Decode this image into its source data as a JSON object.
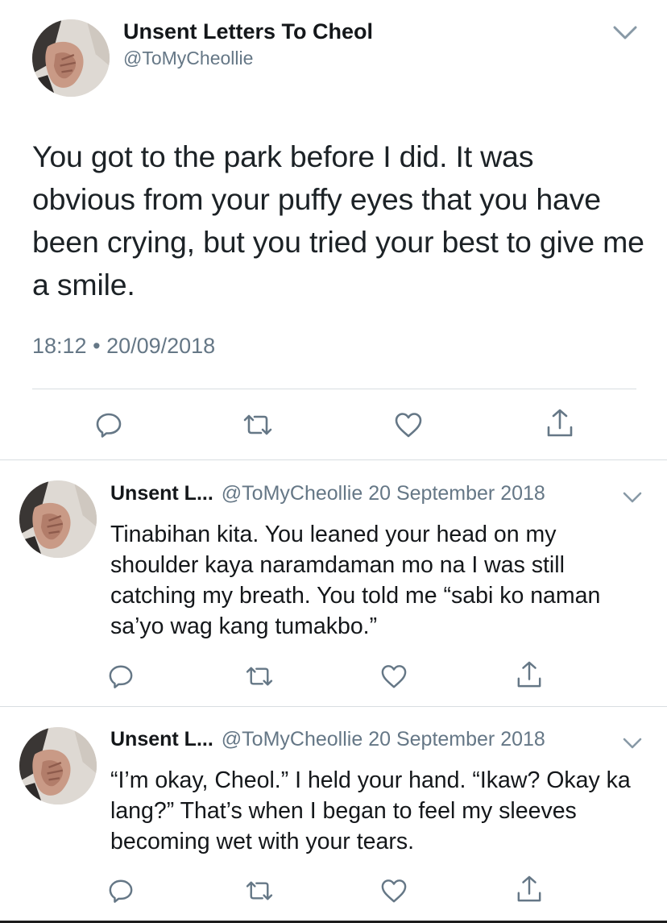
{
  "main_tweet": {
    "display_name": "Unsent Letters To Cheol",
    "handle": "@ToMyCheollie",
    "text": "You got to the park before I did. It was obvious from your puffy eyes that you have been crying, but you tried your best to give me a smile.",
    "time": "18:12",
    "separator": "•",
    "date": "20/09/2018",
    "icons": [
      "reply-icon",
      "retweet-icon",
      "like-icon",
      "share-icon"
    ]
  },
  "replies": [
    {
      "display_name": "Unsent L...",
      "handle": "@ToMyCheollie",
      "date": "20 September 2018",
      "text": "Tinabihan kita. You leaned your head on my shoulder kaya naramdaman mo na I was still catching my breath. You told me “sabi ko naman sa’yo wag kang tumakbo.”"
    },
    {
      "display_name": "Unsent L...",
      "handle": "@ToMyCheollie",
      "date": "20 September 2018",
      "text": "“I’m okay, Cheol.” I held your hand. “Ikaw? Okay ka lang?” That’s when I began to feel my sleeves becoming wet with your tears."
    }
  ],
  "colors": {
    "text": "#14171a",
    "secondary": "#657786",
    "divider": "#d8dde1",
    "icon": "#657786"
  }
}
